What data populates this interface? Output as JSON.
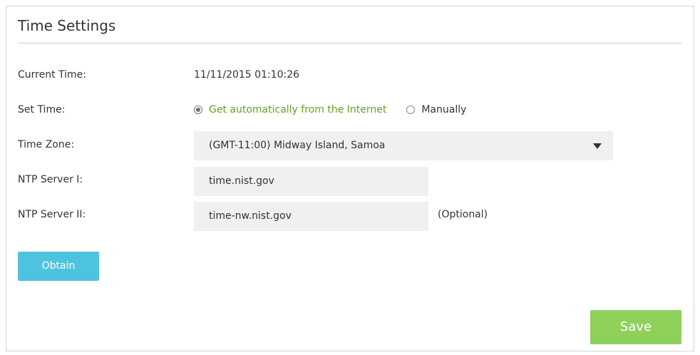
{
  "panel": {
    "title": "Time Settings"
  },
  "fields": {
    "current_time": {
      "label": "Current Time:",
      "value": "11/11/2015 01:10:26"
    },
    "set_time": {
      "label": "Set Time:",
      "options": [
        {
          "label": "Get automatically from the Internet",
          "checked": true
        },
        {
          "label": "Manually",
          "checked": false
        }
      ]
    },
    "time_zone": {
      "label": "Time Zone:",
      "selected": "(GMT-11:00) Midway Island, Samoa"
    },
    "ntp_server_1": {
      "label": "NTP Server I:",
      "value": "time.nist.gov"
    },
    "ntp_server_2": {
      "label": "NTP Server II:",
      "value": "time-nw.nist.gov",
      "hint": "(Optional)"
    }
  },
  "buttons": {
    "obtain": "Obtain",
    "save": "Save"
  },
  "colors": {
    "accent_green": "#5ba625",
    "obtain_button": "#4ec3e0",
    "save_button": "#8fd05a",
    "input_bg": "#f0f0f0"
  }
}
